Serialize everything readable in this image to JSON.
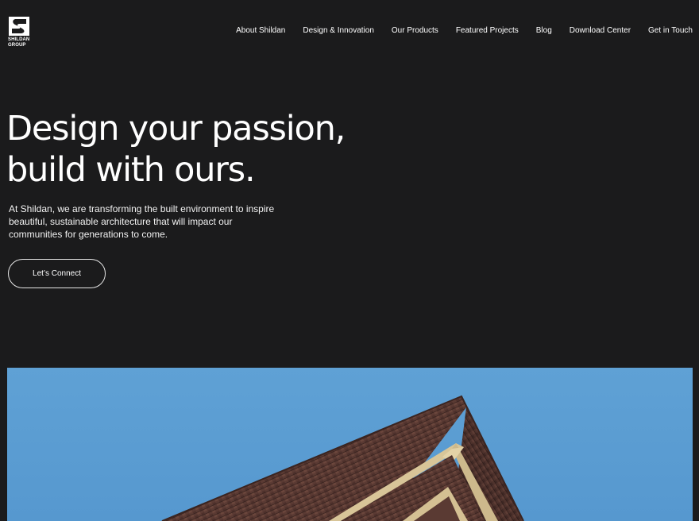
{
  "brand": {
    "name_line1": "SHILDAN",
    "name_line2": "GROUP"
  },
  "nav": {
    "items": [
      {
        "label": "About Shildan"
      },
      {
        "label": "Design & Innovation"
      },
      {
        "label": "Our Products"
      },
      {
        "label": "Featured Projects"
      },
      {
        "label": "Blog"
      },
      {
        "label": "Download Center"
      },
      {
        "label": "Get in Touch"
      }
    ]
  },
  "hero": {
    "title_line1": "Design your passion,",
    "title_line2": "build with ours.",
    "description": "At Shildan, we are transforming the built environment to inspire beautiful, sustainable architecture that will impact our communities for generations to come.",
    "cta_label": "Let’s Connect"
  },
  "colors": {
    "background": "#1b1b1c",
    "text": "#ffffff",
    "sky": "#5a9cd1",
    "roof": "#5b3a32",
    "trim": "#d9c69a"
  }
}
